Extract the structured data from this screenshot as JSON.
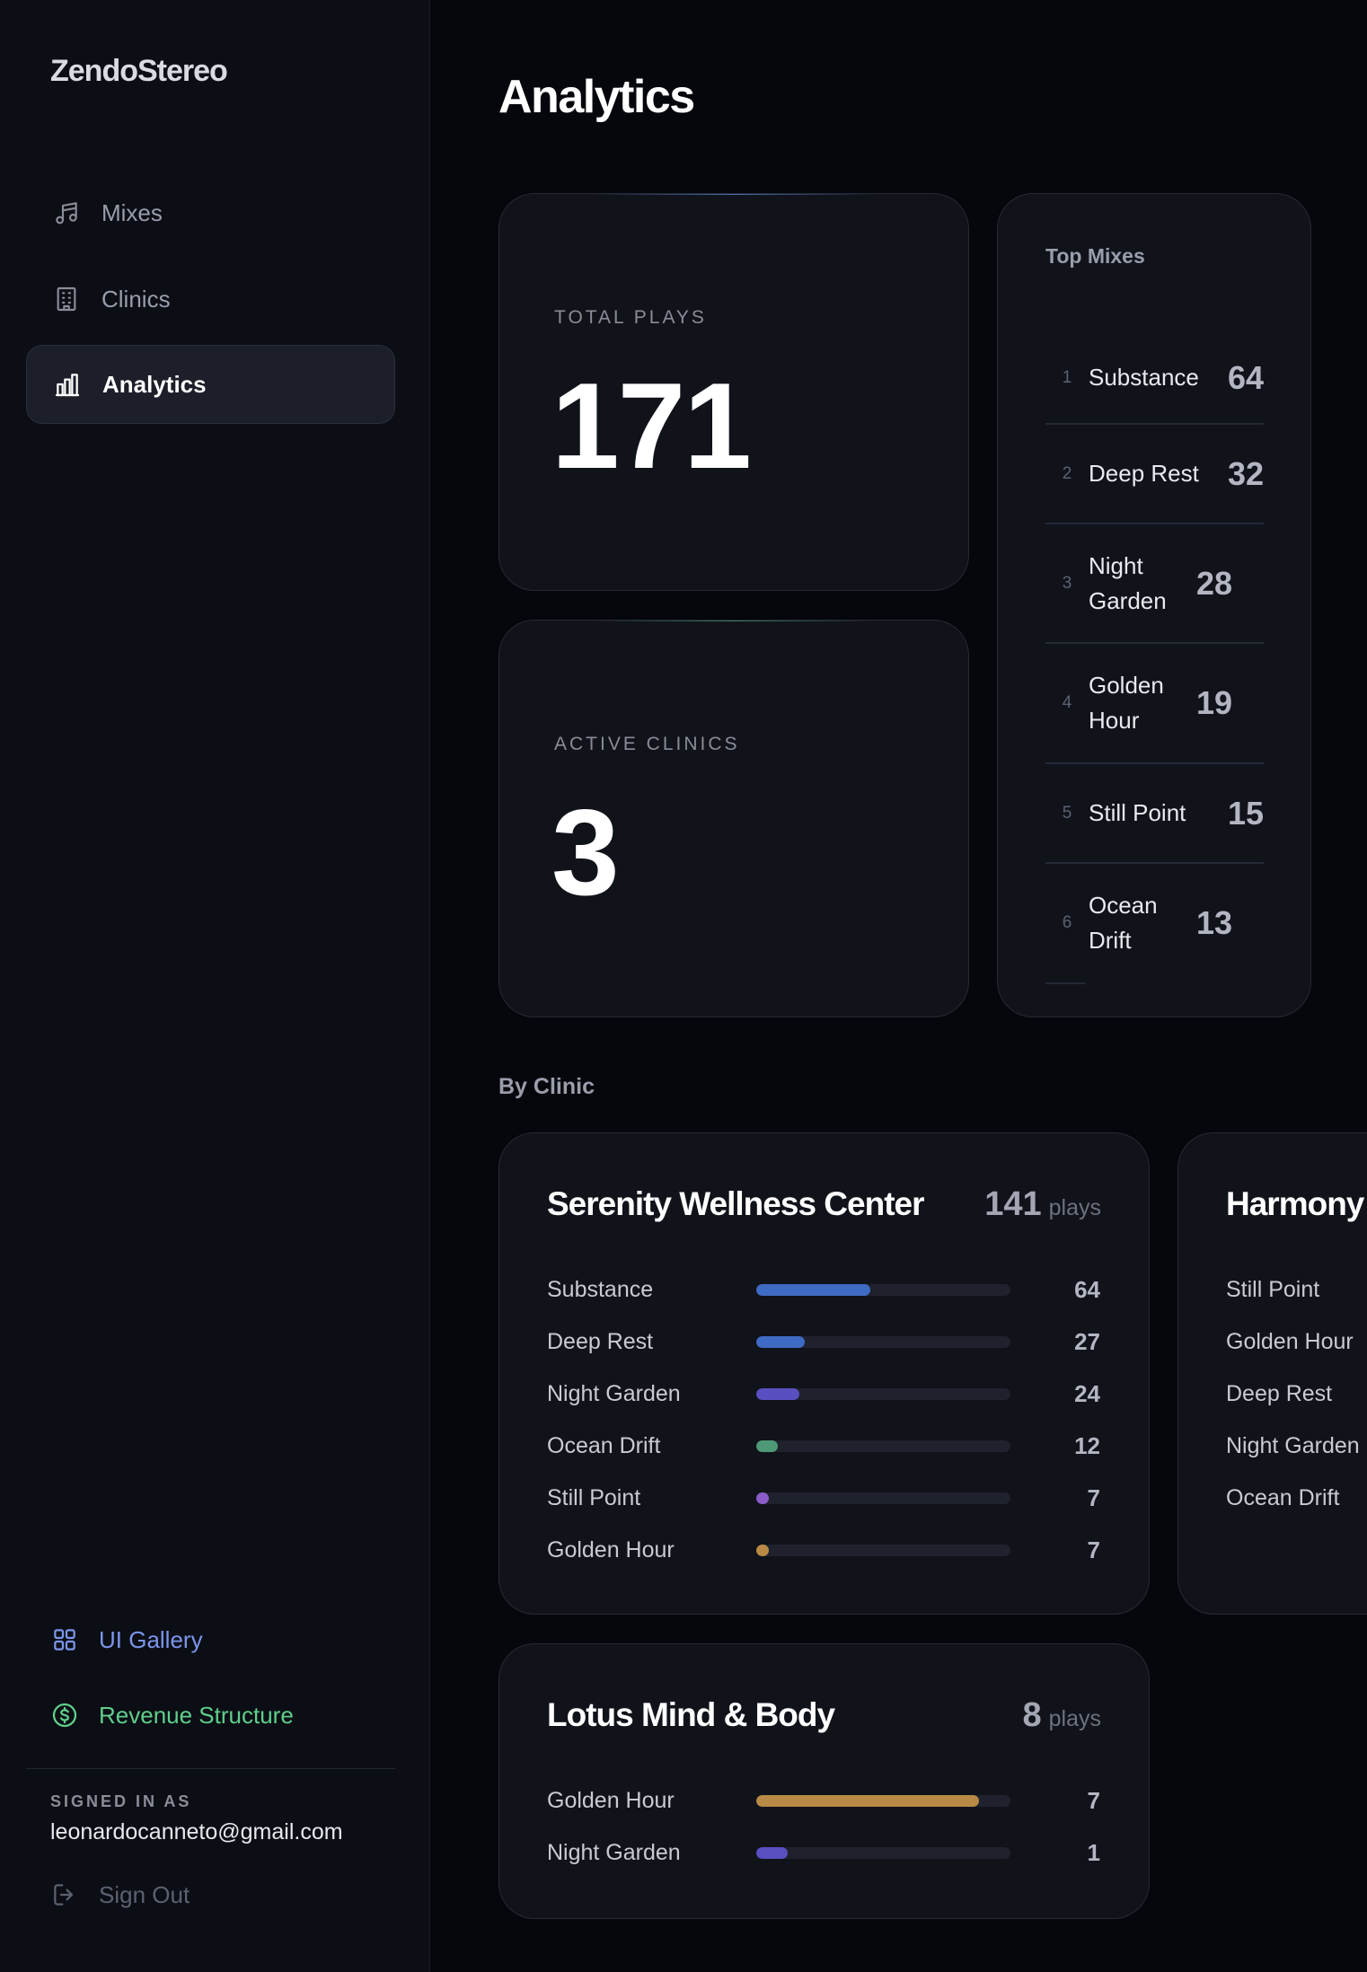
{
  "brand": "ZendoStereo",
  "nav": {
    "items": [
      {
        "label": "Mixes",
        "icon": "music-note-icon"
      },
      {
        "label": "Clinics",
        "icon": "building-icon"
      },
      {
        "label": "Analytics",
        "icon": "bar-chart-icon",
        "active": true
      }
    ]
  },
  "sidebar_footer": {
    "gallery_label": "UI Gallery",
    "revenue_label": "Revenue Structure",
    "signed_in_label": "SIGNED IN AS",
    "email": "leonardocanneto@gmail.com",
    "sign_out_label": "Sign Out"
  },
  "page_title": "Analytics",
  "stats": {
    "total_plays": {
      "label": "TOTAL PLAYS",
      "value": "171"
    },
    "active_clinics": {
      "label": "ACTIVE CLINICS",
      "value": "3"
    }
  },
  "top_mixes": {
    "title": "Top Mixes",
    "items": [
      {
        "rank": "1",
        "name": "Substance",
        "count": "64"
      },
      {
        "rank": "2",
        "name": "Deep Rest",
        "count": "32"
      },
      {
        "rank": "3",
        "name": "Night Garden",
        "count": "28"
      },
      {
        "rank": "4",
        "name": "Golden Hour",
        "count": "19"
      },
      {
        "rank": "5",
        "name": "Still Point",
        "count": "15"
      },
      {
        "rank": "6",
        "name": "Ocean Drift",
        "count": "13"
      }
    ]
  },
  "by_clinic": {
    "label": "By Clinic",
    "plays_unit": "plays",
    "clinics": [
      {
        "name": "Serenity Wellness Center",
        "total": "141",
        "mixes": [
          {
            "name": "Substance",
            "value": "64",
            "fraction": 0.45,
            "color": "#3e6bc4"
          },
          {
            "name": "Deep Rest",
            "value": "27",
            "fraction": 0.19,
            "color": "#3e6bc4"
          },
          {
            "name": "Night Garden",
            "value": "24",
            "fraction": 0.17,
            "color": "#5a4fc0"
          },
          {
            "name": "Ocean Drift",
            "value": "12",
            "fraction": 0.085,
            "color": "#4e9a76"
          },
          {
            "name": "Still Point",
            "value": "7",
            "fraction": 0.05,
            "color": "#8a5cc8"
          },
          {
            "name": "Golden Hour",
            "value": "7",
            "fraction": 0.05,
            "color": "#b88a45"
          }
        ]
      },
      {
        "name": "Harmony",
        "mixes": [
          {
            "name": "Still Point"
          },
          {
            "name": "Golden Hour"
          },
          {
            "name": "Deep Rest"
          },
          {
            "name": "Night Garden"
          },
          {
            "name": "Ocean Drift"
          }
        ]
      },
      {
        "name": "Lotus Mind & Body",
        "total": "8",
        "mixes": [
          {
            "name": "Golden Hour",
            "value": "7",
            "fraction": 0.875,
            "color": "#b88a45"
          },
          {
            "name": "Night Garden",
            "value": "1",
            "fraction": 0.125,
            "color": "#5a4fc0"
          }
        ]
      }
    ]
  }
}
